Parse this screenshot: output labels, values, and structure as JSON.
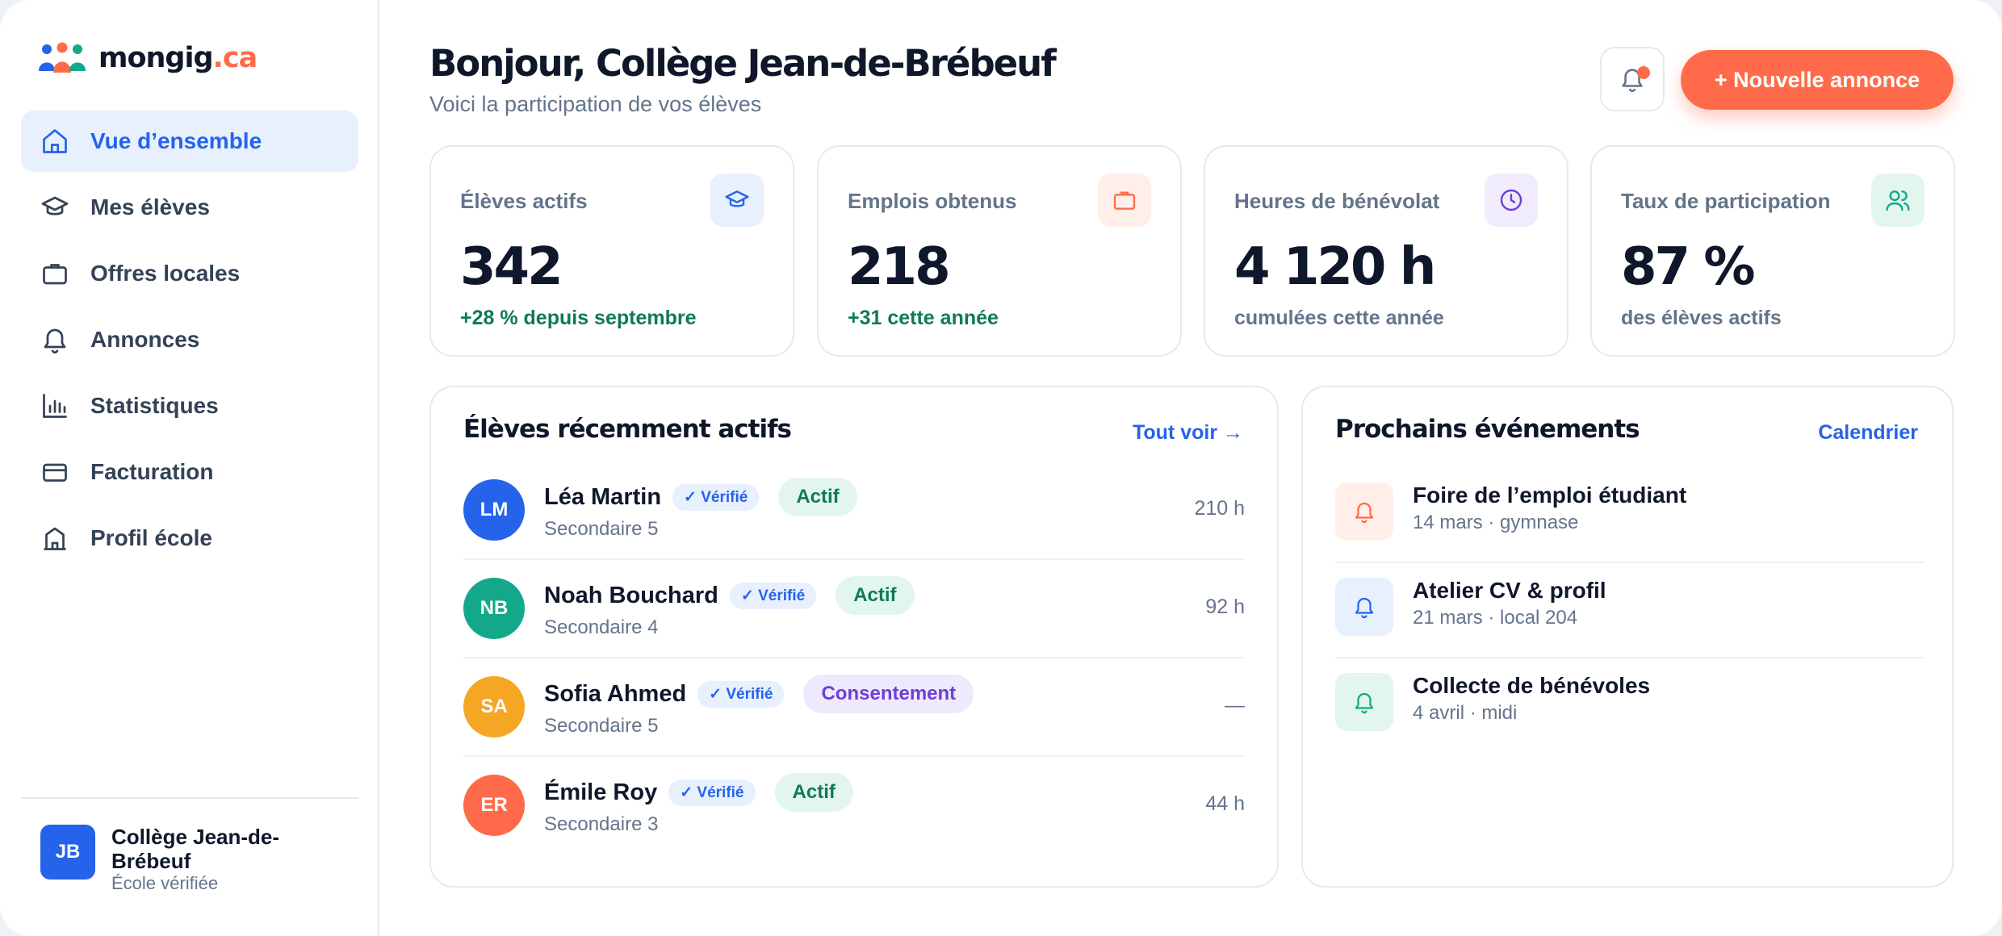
{
  "brand": {
    "name": "mongig",
    "tld": ".ca"
  },
  "sidebar": {
    "items": [
      {
        "label": "Vue d’ensemble",
        "icon": "home-icon",
        "active": true
      },
      {
        "label": "Mes élèves",
        "icon": "graduation-cap-icon"
      },
      {
        "label": "Offres locales",
        "icon": "briefcase-icon"
      },
      {
        "label": "Annonces",
        "icon": "bell-icon"
      },
      {
        "label": "Statistiques",
        "icon": "bar-chart-icon"
      },
      {
        "label": "Facturation",
        "icon": "credit-card-icon"
      },
      {
        "label": "Profil école",
        "icon": "school-building-icon"
      }
    ],
    "footer": {
      "initials": "JB",
      "name": "Collège Jean-de-Brébeuf",
      "status": "École vérifiée"
    }
  },
  "header": {
    "title": "Bonjour, Collège Jean-de-Brébeuf",
    "subtitle": "Voici la participation de vos élèves",
    "new_button": "+ Nouvelle annonce"
  },
  "stats": [
    {
      "label": "Élèves actifs",
      "value": "342",
      "note": "+28 % depuis septembre",
      "icon": "graduation-cap-icon",
      "note_color": "#0f7a54"
    },
    {
      "label": "Emplois obtenus",
      "value": "218",
      "note": "+31 cette année",
      "icon": "briefcase-icon",
      "note_color": "#0f7a54"
    },
    {
      "label": "Heures de bénévolat",
      "value": "4 120 h",
      "note": "cumulées cette année",
      "icon": "clock-icon",
      "note_color": "#64748b"
    },
    {
      "label": "Taux de participation",
      "value": "87 %",
      "note": "des élèves actifs",
      "icon": "users-icon",
      "note_color": "#64748b"
    }
  ],
  "students_panel": {
    "title": "Élèves récemment actifs",
    "link": "Tout voir →",
    "verified_label": "✓ Vérifié",
    "rows": [
      {
        "initials": "LM",
        "name": "Léa Martin",
        "grade": "Secondaire 5",
        "status": "Actif",
        "hours": "210 h",
        "color": "#2563eb"
      },
      {
        "initials": "NB",
        "name": "Noah Bouchard",
        "grade": "Secondaire 4",
        "status": "Actif",
        "hours": "92 h",
        "color": "#14a88a"
      },
      {
        "initials": "SA",
        "name": "Sofia Ahmed",
        "grade": "Secondaire 5",
        "status": "Consentement",
        "hours": "—",
        "color": "#f5a623"
      },
      {
        "initials": "ER",
        "name": "Émile Roy",
        "grade": "Secondaire 3",
        "status": "Actif",
        "hours": "44 h",
        "color": "#ff6b4a"
      }
    ]
  },
  "events_panel": {
    "title": "Prochains événements",
    "link": "Calendrier",
    "events": [
      {
        "title": "Foire de l’emploi étudiant",
        "detail": "14 mars · gymnase",
        "color": "#ff6b4a"
      },
      {
        "title": "Atelier CV & profil",
        "detail": "21 mars · local 204",
        "color": "#2563eb"
      },
      {
        "title": "Collecte de bénévoles",
        "detail": "4 avril · midi",
        "color": "#14a88a"
      }
    ]
  },
  "colors": {
    "accent": "#2563eb",
    "brand": "#ff6b4a",
    "success": "#0f7a54"
  }
}
